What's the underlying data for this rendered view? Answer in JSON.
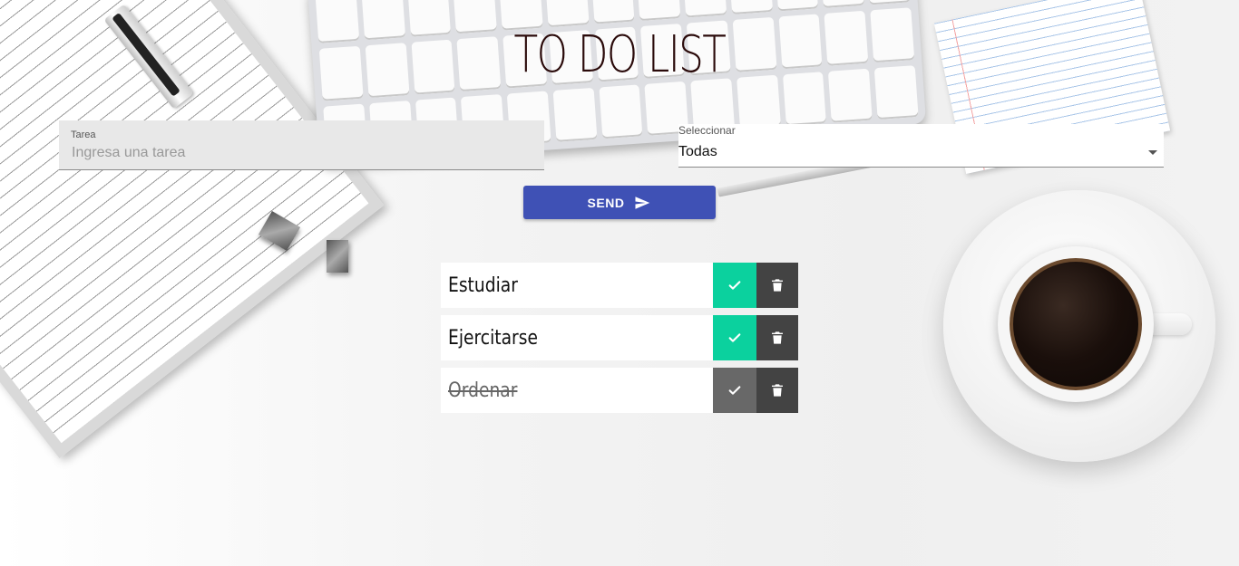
{
  "app": {
    "title": "TO DO LIST"
  },
  "form": {
    "task_label": "Tarea",
    "task_placeholder": "Ingresa una tarea",
    "task_value": "",
    "filter_label": "Seleccionar",
    "filter_value": "Todas",
    "send_label": "SEND"
  },
  "tasks": [
    {
      "text": "Estudiar",
      "done": false
    },
    {
      "text": "Ejercitarse",
      "done": false
    },
    {
      "text": "Ordenar",
      "done": true
    }
  ],
  "colors": {
    "primary": "#3f51b5",
    "check_active": "#0bd19e",
    "check_done": "#686868",
    "trash": "#434343"
  },
  "icons": {
    "send": "send-icon",
    "check": "check-icon",
    "trash": "trash-icon"
  }
}
